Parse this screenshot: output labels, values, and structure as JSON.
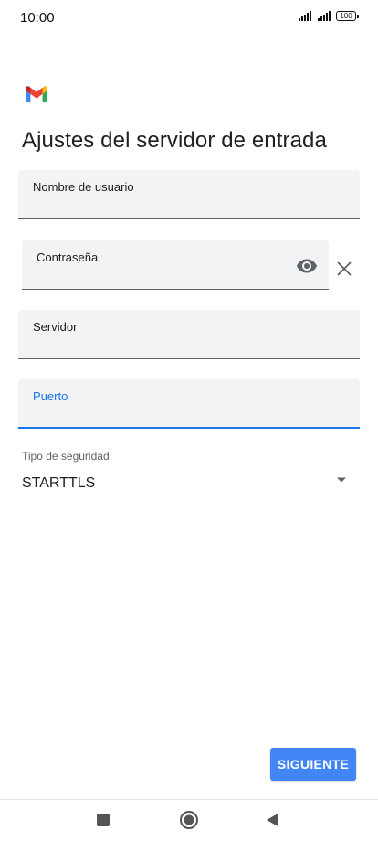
{
  "status_bar": {
    "time": "10:00",
    "battery": "100"
  },
  "header": {
    "logo": "gmail-logo",
    "title": "Ajustes del servidor de entrada"
  },
  "form": {
    "username": {
      "label": "Nombre de usuario",
      "value": ""
    },
    "password": {
      "label": "Contraseña",
      "value": "",
      "toggle_icon": "eye-icon",
      "clear_icon": "close-icon"
    },
    "server": {
      "label": "Servidor",
      "value": ""
    },
    "port": {
      "label": "Puerto",
      "value": "",
      "focused": true
    },
    "security": {
      "label": "Tipo de seguridad",
      "selected": "STARTTLS",
      "icon": "dropdown-arrow-icon"
    }
  },
  "actions": {
    "next_label": "SIGUIENTE"
  },
  "nav_bar": {
    "recents_icon": "square-icon",
    "home_icon": "circle-icon",
    "back_icon": "triangle-back-icon"
  },
  "colors": {
    "accent": "#1a73e8",
    "button": "#4285f4",
    "field_bg": "#f1f3f4",
    "text": "#202124"
  }
}
